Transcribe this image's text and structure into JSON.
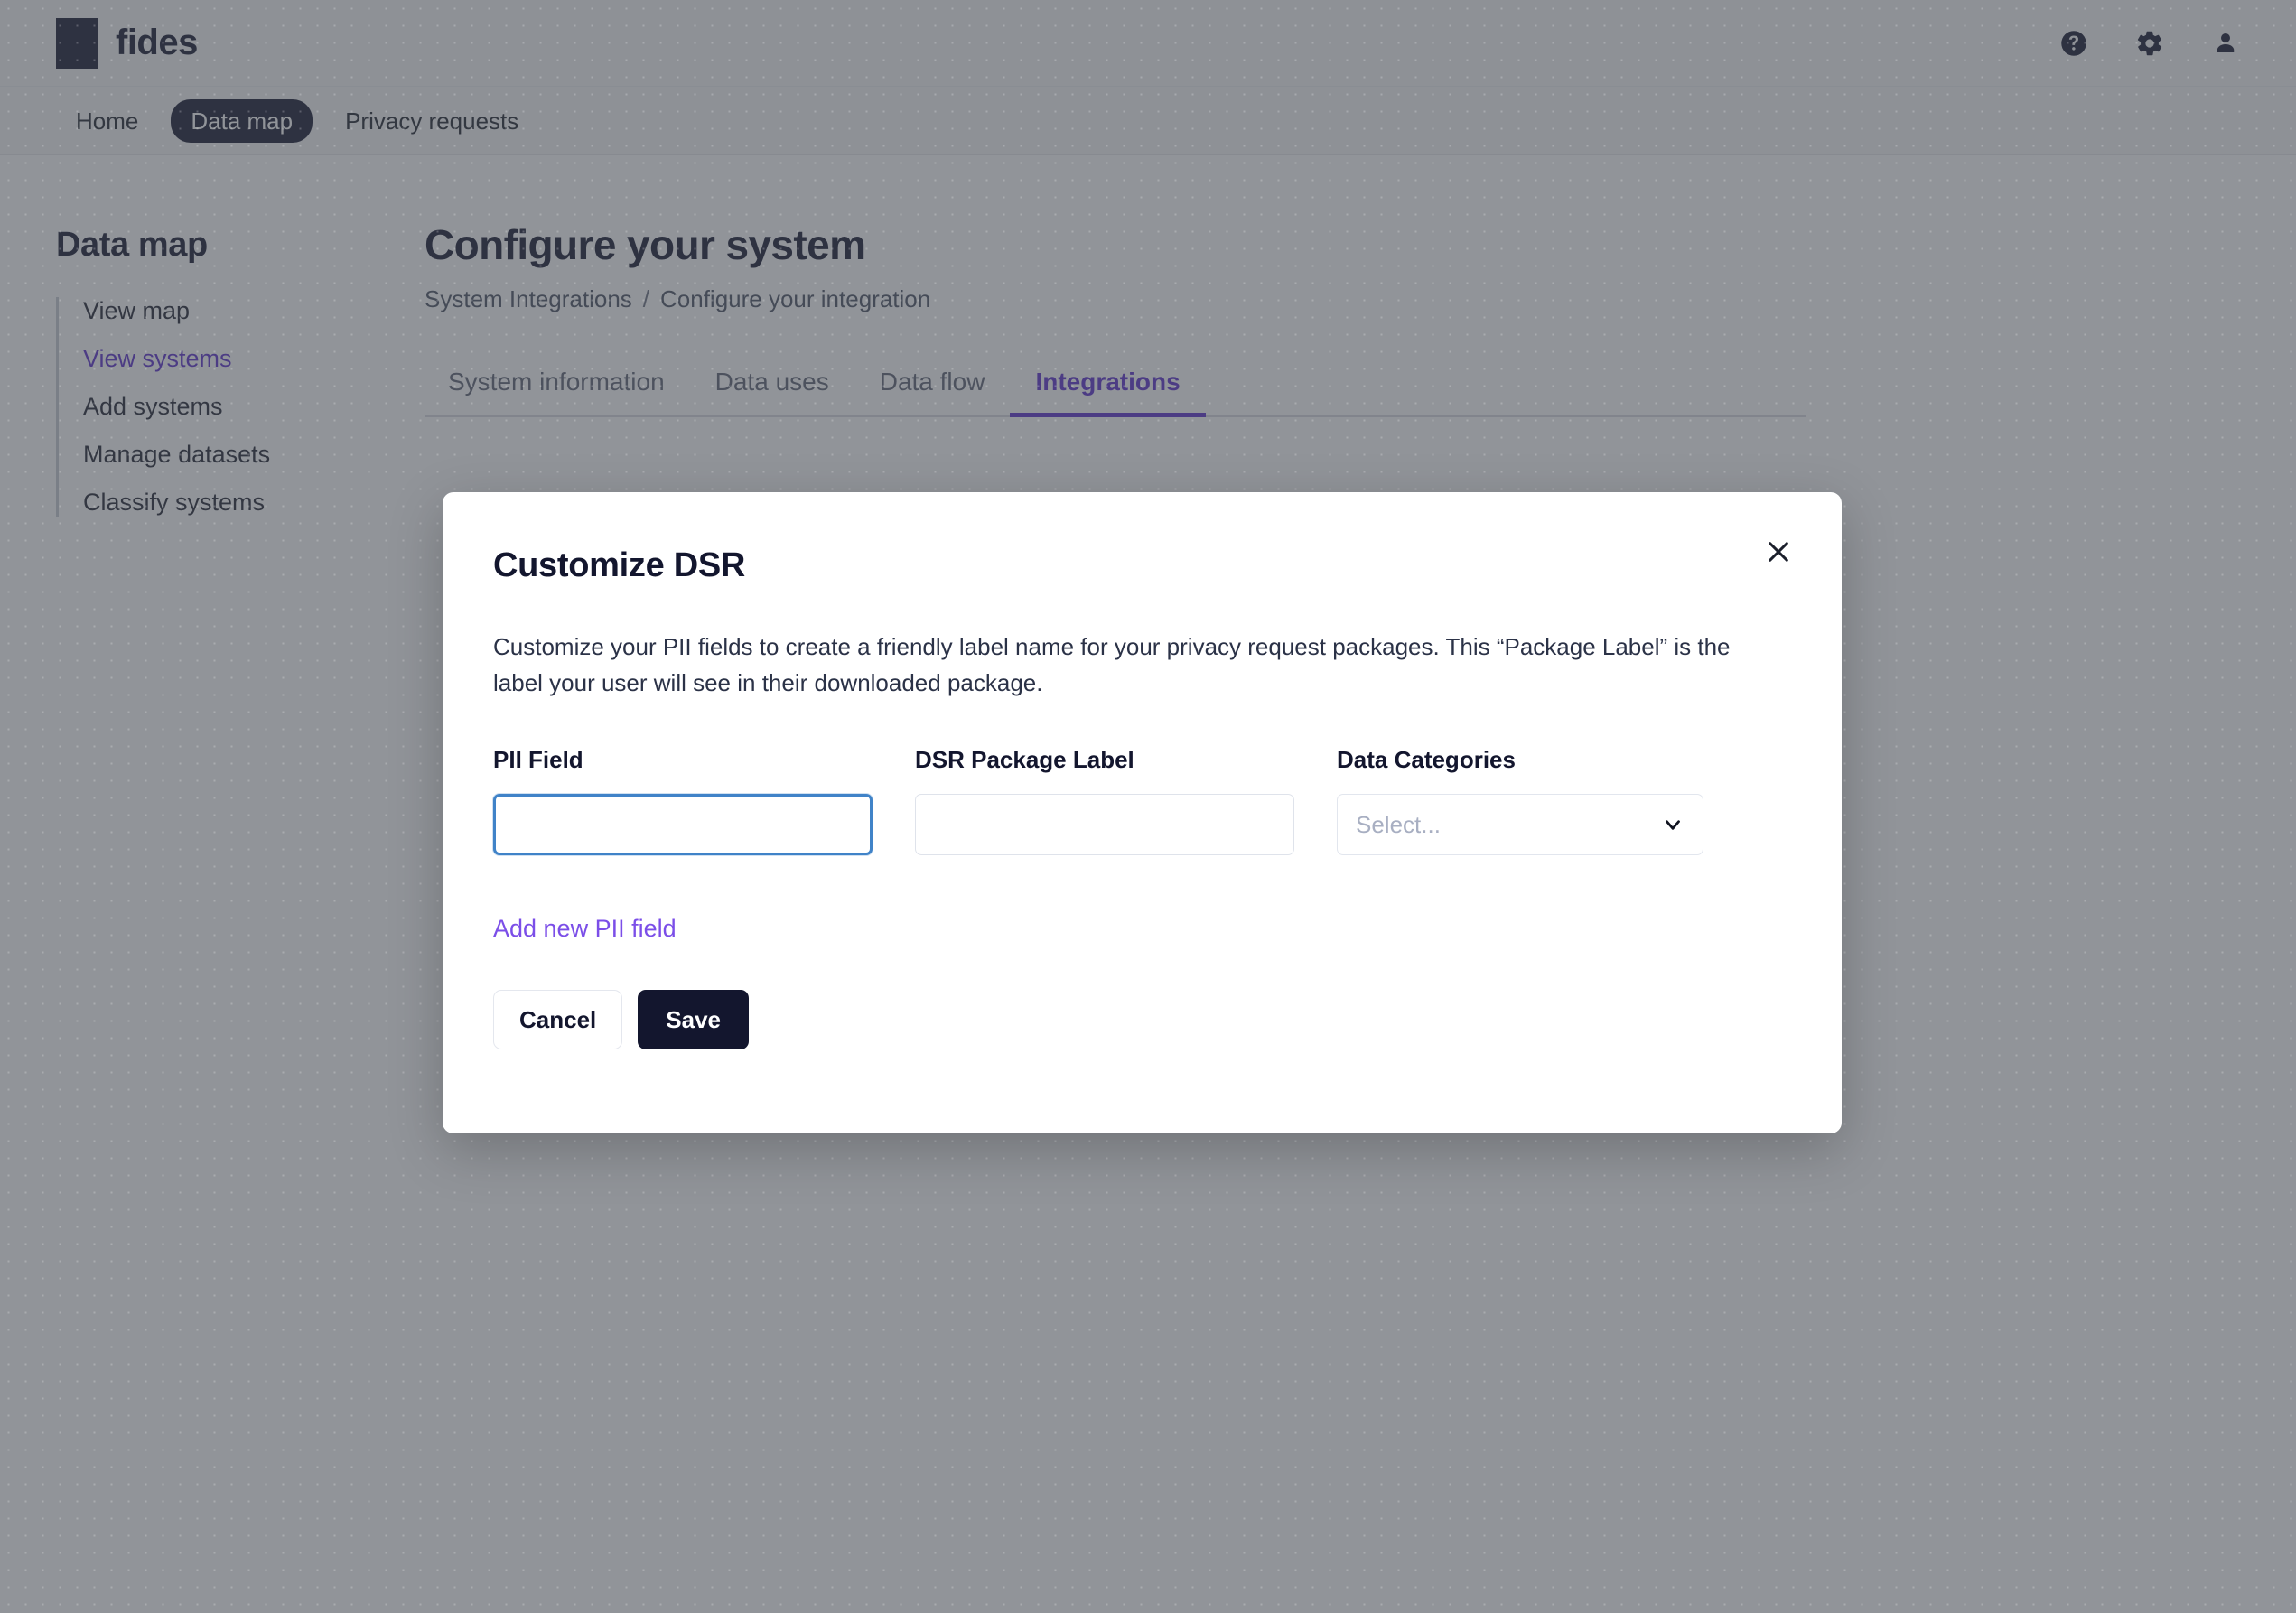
{
  "header": {
    "brand": "fides",
    "brand_mark_color": "#13162e",
    "icons": [
      {
        "name": "help-icon",
        "glyph": "help"
      },
      {
        "name": "gear-icon",
        "glyph": "gear"
      },
      {
        "name": "user-icon",
        "glyph": "user"
      }
    ]
  },
  "nav": {
    "items": [
      {
        "label": "Home",
        "active": false
      },
      {
        "label": "Data map",
        "active": true
      },
      {
        "label": "Privacy requests",
        "active": false
      }
    ]
  },
  "sidebar": {
    "title": "Data map",
    "items": [
      {
        "label": "View map",
        "active": false
      },
      {
        "label": "View systems",
        "active": true
      },
      {
        "label": "Add systems",
        "active": false
      },
      {
        "label": "Manage datasets",
        "active": false
      },
      {
        "label": "Classify systems",
        "active": false
      }
    ]
  },
  "main": {
    "page_title": "Configure your system",
    "breadcrumb": {
      "first": "System Integrations",
      "separator": "/",
      "current": "Configure your integration"
    },
    "tabs": [
      {
        "label": "System information",
        "active": false
      },
      {
        "label": "Data uses",
        "active": false
      },
      {
        "label": "Data flow",
        "active": false
      },
      {
        "label": "Integrations",
        "active": true
      }
    ]
  },
  "modal": {
    "title": "Customize DSR",
    "description": "Customize your PII fields to create a friendly label name for your privacy request packages. This “Package Label” is the label your user will see in their downloaded package.",
    "close_label": "Close",
    "fields": {
      "pii_field": {
        "label": "PII Field",
        "value": "",
        "placeholder": "",
        "focused": true
      },
      "dsr_package_label": {
        "label": "DSR Package Label",
        "value": "",
        "placeholder": ""
      },
      "data_categories": {
        "label": "Data Categories",
        "placeholder": "Select...",
        "value": ""
      }
    },
    "add_link": "Add new PII field",
    "actions": {
      "cancel": "Cancel",
      "save": "Save"
    }
  },
  "colors": {
    "brand_dark": "#13162e",
    "accent_purple": "#5b2fcc",
    "link_purple": "#7b4ee8",
    "focus_blue": "#4083c8",
    "overlay": "rgba(66,70,80,0.58)"
  }
}
